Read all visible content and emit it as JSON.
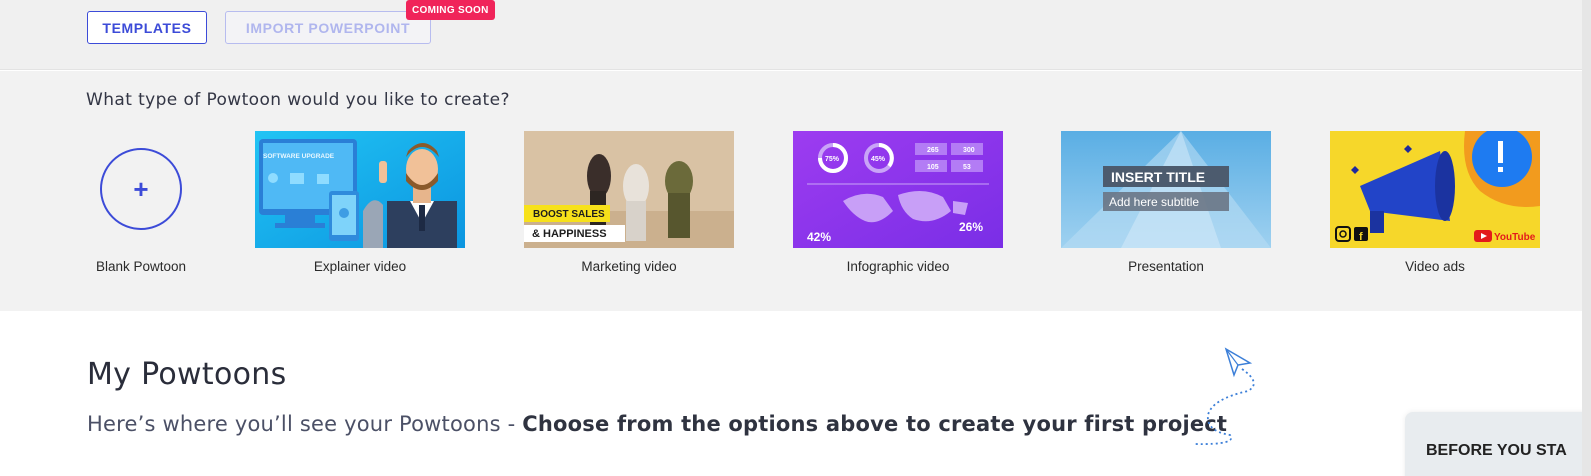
{
  "toolbar": {
    "templates_label": "TEMPLATES",
    "import_label": "IMPORT POWERPOINT",
    "coming_soon": "COMING SOON"
  },
  "types": {
    "title": "What type of Powtoon would you like to create?",
    "blank": {
      "icon": "plus-icon",
      "glyph": "+",
      "label": "Blank Powtoon"
    },
    "cards": [
      {
        "label": "Explainer video",
        "thumb_text": "SOFTWARE UPGRADE"
      },
      {
        "label": "Marketing video",
        "thumb_text_1": "BOOST SALES",
        "thumb_text_2": "& HAPPINESS"
      },
      {
        "label": "Infographic video",
        "pct_1": "75%",
        "pct_2": "45%",
        "stat_1": "265",
        "stat_2": "300",
        "stat_3": "105",
        "stat_4": "53",
        "big_1": "42%",
        "big_2": "26%"
      },
      {
        "label": "Presentation",
        "thumb_title": "INSERT TITLE",
        "thumb_subtitle": "Add here subtitle"
      },
      {
        "label": "Video ads",
        "youtube": "YouTube"
      }
    ]
  },
  "my_powtoons": {
    "title": "My Powtoons",
    "subtitle_plain": "Here’s where you’ll see your Powtoons - ",
    "subtitle_bold": "Choose from the options above to create your first project"
  },
  "before_you_start": "BEFORE YOU STA",
  "colors": {
    "accent": "#3c4bd8",
    "badge": "#f0245a",
    "section_bg": "#f2f2f2"
  }
}
